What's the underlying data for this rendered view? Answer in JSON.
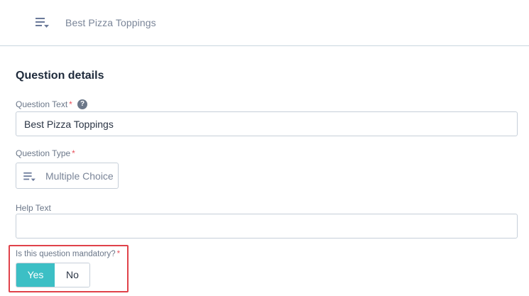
{
  "header": {
    "icon": "list-question-icon",
    "title": "Best Pizza Toppings"
  },
  "section": {
    "title": "Question details"
  },
  "question_text": {
    "label": "Question Text",
    "required_mark": "*",
    "help_icon": "help-circle-icon",
    "help_glyph": "?",
    "value": "Best Pizza Toppings"
  },
  "question_type": {
    "label": "Question Type",
    "required_mark": "*",
    "icon": "list-question-icon",
    "value": "Multiple Choice"
  },
  "help_text": {
    "label": "Help Text",
    "value": ""
  },
  "mandatory": {
    "label": "Is this question mandatory?",
    "required_mark": "*",
    "options": [
      "Yes",
      "No"
    ],
    "selected": "Yes"
  },
  "colors": {
    "accent": "#3cbfc5",
    "required": "#e8505b",
    "highlight": "#e0424a"
  }
}
